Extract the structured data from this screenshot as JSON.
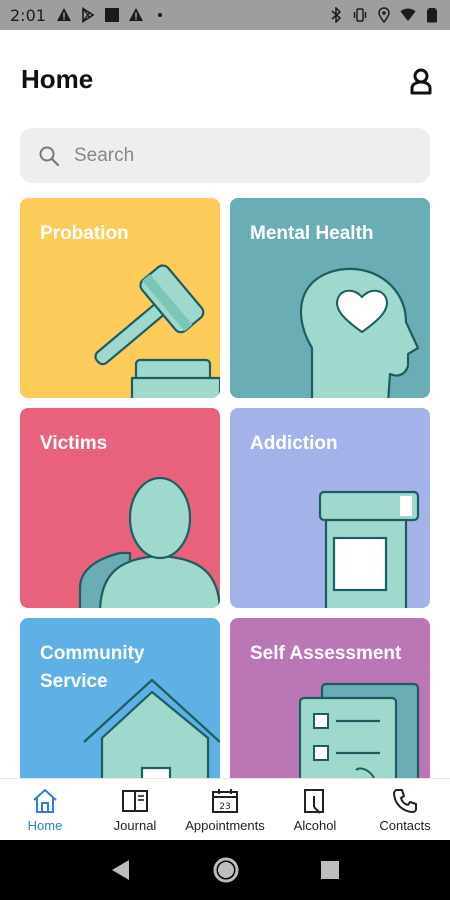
{
  "status_bar": {
    "time": "2:01",
    "left_icons": [
      "warning-icon",
      "play-store-icon",
      "square-icon",
      "warning-icon",
      "dot-icon"
    ],
    "right_icons": [
      "bluetooth-icon",
      "vibrate-icon",
      "location-icon",
      "wifi-icon",
      "battery-icon"
    ]
  },
  "header": {
    "title": "Home",
    "profile_icon": "user-icon"
  },
  "search": {
    "placeholder": "Search",
    "icon": "search-icon"
  },
  "cards": [
    {
      "label": "Probation",
      "color": "#fdcb5a",
      "icon": "gavel-icon"
    },
    {
      "label": "Mental Health",
      "color": "#6aadb4",
      "icon": "head-heart-icon"
    },
    {
      "label": "Victims",
      "color": "#e8627c",
      "icon": "person-icon"
    },
    {
      "label": "Addiction",
      "color": "#a3b3ea",
      "icon": "pill-bottle-icon"
    },
    {
      "label": "Community Service",
      "color": "#5fb0e4",
      "icon": "house-icon"
    },
    {
      "label": "Self Assessment",
      "color": "#bb76b5",
      "icon": "checklist-icon"
    }
  ],
  "bottom_nav": {
    "items": [
      {
        "label": "Home",
        "icon": "home-icon",
        "active": true
      },
      {
        "label": "Journal",
        "icon": "journal-icon",
        "active": false
      },
      {
        "label": "Appointments",
        "icon": "calendar-icon",
        "active": false
      },
      {
        "label": "Alcohol",
        "icon": "bottle-icon",
        "active": false
      },
      {
        "label": "Contacts",
        "icon": "phone-icon",
        "active": false
      }
    ],
    "calendar_day": "23",
    "active_color": "#2e7de0"
  },
  "android_nav": [
    "back-icon",
    "home-circle-icon",
    "recents-icon"
  ],
  "colors": {
    "illustration_fill": "#9fd8cd",
    "illustration_stroke": "#1d5c60"
  }
}
